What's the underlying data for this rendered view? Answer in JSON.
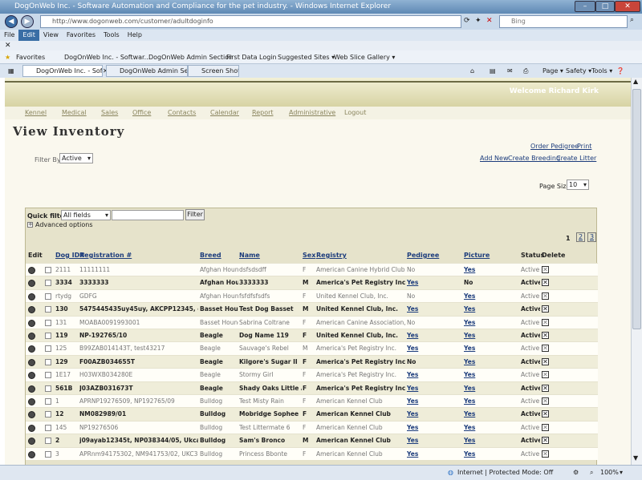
{
  "window": {
    "title": "DogOnWeb Inc. - Software Automation and Compliance for the pet industry. - Windows Internet Explorer"
  },
  "address": {
    "url": "http://www.dogonweb.com/customer/adultdoginfo",
    "search_placeholder": "Bing"
  },
  "menu": [
    "File",
    "Edit",
    "View",
    "Favorites",
    "Tools",
    "Help"
  ],
  "favorites": {
    "label": "Favorites",
    "items": [
      "DogOnWeb Inc. - Softwar...",
      "DogOnWeb Admin Section",
      "First Data Login",
      "Suggested Sites ▾",
      "Web Slice Gallery ▾"
    ]
  },
  "tabs": [
    "DogOnWeb Inc. - Soft...",
    "DogOnWeb Admin Section",
    "Screen Shots"
  ],
  "tab_tools": [
    "Page ▾",
    "Safety ▾",
    "Tools ▾"
  ],
  "site": {
    "welcome": "Welcome Richard Kirk",
    "nav": [
      "Kennel",
      "Medical",
      "Sales",
      "Office",
      "Contacts",
      "Calendar",
      "Report",
      "Administrative",
      "Logout"
    ],
    "title": "View Inventory",
    "filter_label": "Filter By:",
    "filter_value": "Active",
    "order_pedigree": "Order Pedigree",
    "print": "Print",
    "add_new": "Add New",
    "create_breeding": "Create Breeding",
    "create_litter": "Create Litter",
    "page_size_label": "Page Size:",
    "page_size_value": "10",
    "quick_filter_label": "Quick filter:",
    "quick_filter_field": "All fields",
    "filter_button": "Filter",
    "advanced_options": "Advanced options",
    "pages": [
      "1",
      "2",
      "3"
    ]
  },
  "table": {
    "headers": {
      "edit": "Edit",
      "dog_id": "Dog ID#",
      "reg": "Registration #",
      "breed": "Breed",
      "name": "Name",
      "sex": "Sex",
      "registry": "Registry",
      "pedigree": "Pedigree",
      "picture": "Picture",
      "status": "Status",
      "delete": "Delete"
    },
    "rows": [
      {
        "id": "2111",
        "reg": "11111111",
        "breed": "Afghan Hound",
        "name": "dsfsdsdff",
        "sex": "F",
        "registry": "American Canine Hybrid Club",
        "pedigree": "No",
        "picture": "Yes",
        "status": "Active",
        "bold": false
      },
      {
        "id": "3334",
        "reg": "3333333",
        "breed": "Afghan Hound",
        "name": "3333333",
        "sex": "M",
        "registry": "America's Pet Registry Inc.",
        "pedigree": "Yes",
        "picture": "No",
        "status": "Active",
        "bold": true
      },
      {
        "id": "rtydg",
        "reg": "GDFG",
        "breed": "Afghan Hound",
        "name": "fsfdfsfsdfs",
        "sex": "F",
        "registry": "United Kennel Club, Inc.",
        "pedigree": "No",
        "picture": "Yes",
        "status": "Active",
        "bold": false
      },
      {
        "id": "130",
        "reg": "5475445435uy45uy, AKCPP12345, ckc238479587",
        "breed": "Basset Hound",
        "name": "Test Dog Basset",
        "sex": "M",
        "registry": "United Kennel Club, Inc.",
        "pedigree": "Yes",
        "picture": "Yes",
        "status": "Active",
        "bold": true
      },
      {
        "id": "131",
        "reg": "MOABA0091993001",
        "breed": "Basset Hound",
        "name": "Sabrina Coltrane",
        "sex": "F",
        "registry": "American Canine Association, Inc.",
        "pedigree": "No",
        "picture": "Yes",
        "status": "Active",
        "bold": false
      },
      {
        "id": "119",
        "reg": "NP-192765/10",
        "breed": "Beagle",
        "name": "Dog Name 119",
        "sex": "F",
        "registry": "United Kennel Club, Inc.",
        "pedigree": "Yes",
        "picture": "Yes",
        "status": "Active",
        "bold": true
      },
      {
        "id": "125",
        "reg": "B99ZAB014143T, test43217",
        "breed": "Beagle",
        "name": "Sauvage's Rebel",
        "sex": "M",
        "registry": "America's Pet Registry Inc.",
        "pedigree": "Yes",
        "picture": "Yes",
        "status": "Active",
        "bold": false
      },
      {
        "id": "129",
        "reg": "F00AZB034655T",
        "breed": "Beagle",
        "name": "Kilgore's Sugar II",
        "sex": "F",
        "registry": "America's Pet Registry Inc.",
        "pedigree": "No",
        "picture": "Yes",
        "status": "Active",
        "bold": true
      },
      {
        "id": "1E17",
        "reg": "H03WXB034280E",
        "breed": "Beagle",
        "name": "Stormy Girl",
        "sex": "F",
        "registry": "America's Pet Registry Inc.",
        "pedigree": "Yes",
        "picture": "Yes",
        "status": "Active",
        "bold": false
      },
      {
        "id": "561B",
        "reg": "J03AZB031673T",
        "breed": "Beagle",
        "name": "Shady Oaks Little Annie",
        "sex": "F",
        "registry": "America's Pet Registry Inc.",
        "pedigree": "Yes",
        "picture": "Yes",
        "status": "Active",
        "bold": true
      },
      {
        "id": "1",
        "reg": "APRNP19276509, NP192765/09",
        "breed": "Bulldog",
        "name": "Test Misty Rain",
        "sex": "F",
        "registry": "American Kennel Club",
        "pedigree": "Yes",
        "picture": "Yes",
        "status": "Active",
        "bold": false
      },
      {
        "id": "12",
        "reg": "NM082989/01",
        "breed": "Bulldog",
        "name": "Mobridge Sophee",
        "sex": "F",
        "registry": "American Kennel Club",
        "pedigree": "Yes",
        "picture": "Yes",
        "status": "Active",
        "bold": true
      },
      {
        "id": "145",
        "reg": "NP19276506",
        "breed": "Bulldog",
        "name": "Test Littermate 6",
        "sex": "F",
        "registry": "American Kennel Club",
        "pedigree": "Yes",
        "picture": "Yes",
        "status": "Active",
        "bold": false
      },
      {
        "id": "2",
        "reg": "j09ayab12345t, NP038344/05, Ukcanksf0097",
        "breed": "Bulldog",
        "name": "Sam's Bronco",
        "sex": "M",
        "registry": "American Kennel Club",
        "pedigree": "Yes",
        "picture": "Yes",
        "status": "Active",
        "bold": true
      },
      {
        "id": "3",
        "reg": "APRnm94175302, NM941753/02, UKC321456676",
        "breed": "Bulldog",
        "name": "Princess Bbonte",
        "sex": "F",
        "registry": "American Kennel Club",
        "pedigree": "Yes",
        "picture": "Yes",
        "status": "Active",
        "bold": false
      }
    ]
  },
  "statusbar": {
    "zone": "Internet | Protected Mode: Off",
    "zoom": "100%"
  }
}
